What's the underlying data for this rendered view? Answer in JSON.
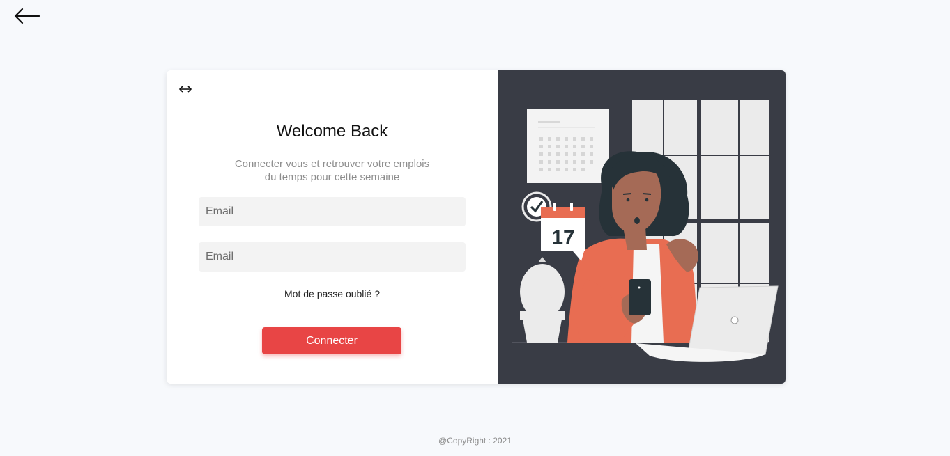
{
  "nav": {
    "back_icon": "arrow-left-icon"
  },
  "login": {
    "swap_icon": "left-right-arrow-icon",
    "title": "Welcome Back",
    "subtitle_line1": "Connecter vous et retrouver votre emplois",
    "subtitle_line2": "du temps pour cette semaine",
    "field1_placeholder": "Email",
    "field2_placeholder": "Email",
    "forgot_label": "Mot de passe oublié ?",
    "submit_label": "Connecter"
  },
  "illustration": {
    "calendar_day": "17"
  },
  "colors": {
    "accent": "#e84545",
    "panel_dark": "#393c45",
    "background": "#f7f9fc"
  },
  "footer": {
    "copyright": "@CopyRight : 2021"
  }
}
